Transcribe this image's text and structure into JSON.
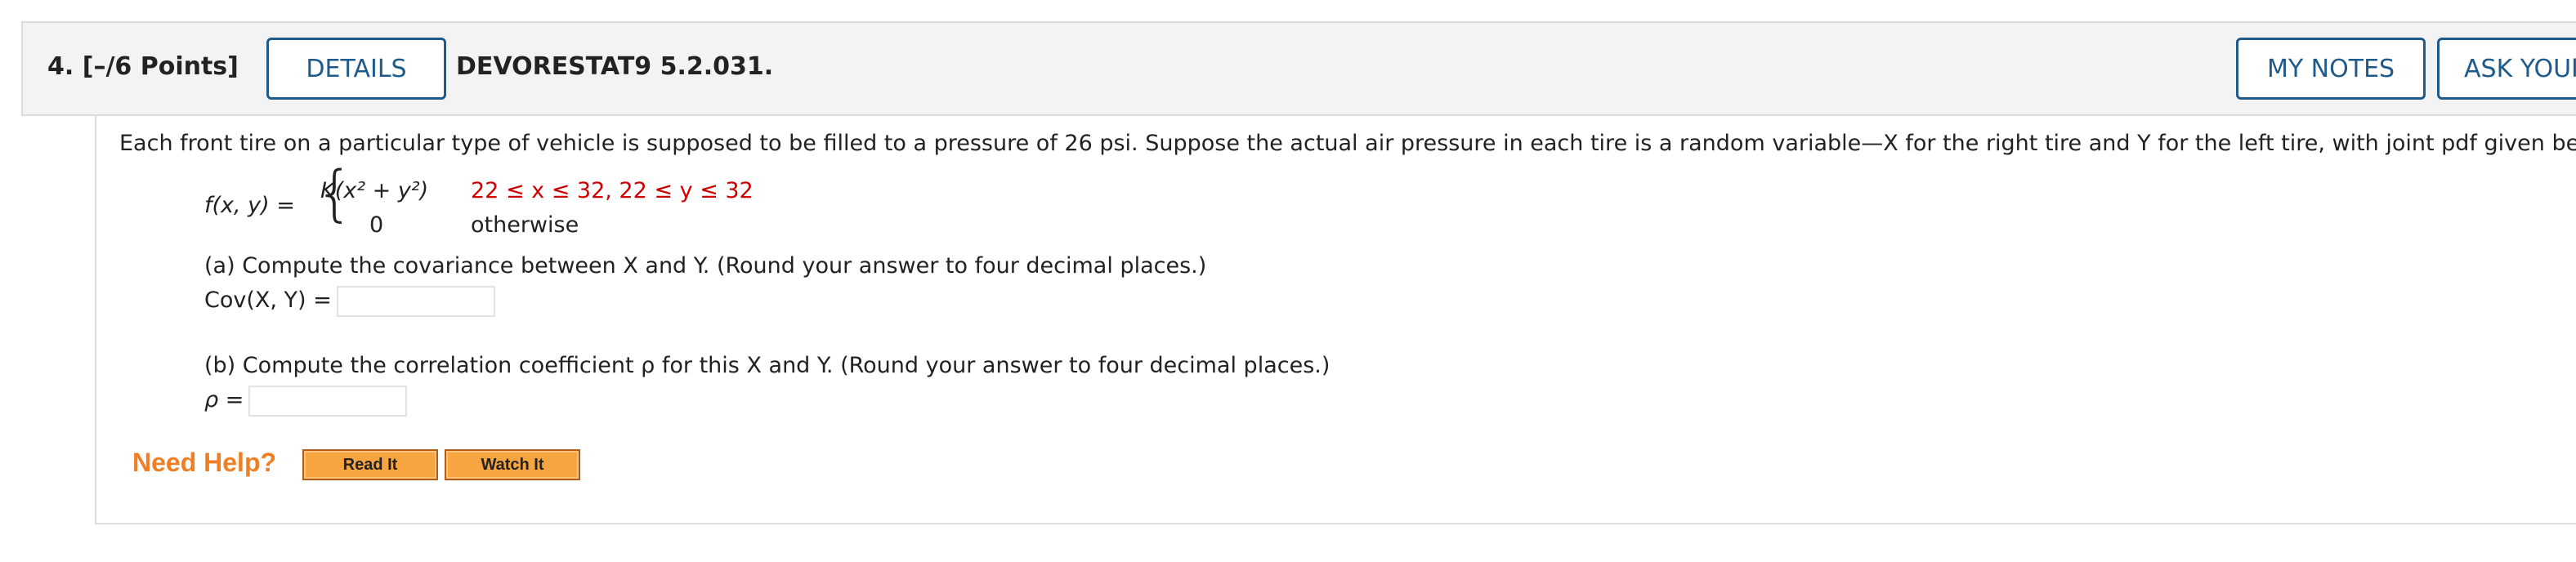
{
  "header": {
    "question_number": "4.",
    "points": "[–/6 Points]",
    "details_label": "DETAILS",
    "assignment_code": "DEVORESTAT9 5.2.031.",
    "my_notes_label": "MY NOTES",
    "ask_your_label": "ASK YOUR TEACHER"
  },
  "problem": {
    "intro": "Each front tire on a particular type of vehicle is supposed to be filled to a pressure of 26 psi. Suppose the actual air pressure in each tire is a random variable—X for the right tire and Y for the left tire, with joint pdf given below.",
    "pdf_lhs": "f(x, y) =",
    "case1_expr": "K(x² + y²)",
    "case1_range": "22 ≤ x ≤ 32, 22 ≤ y ≤ 32",
    "case2_expr": "0",
    "case2_range": "otherwise",
    "part_a": "(a) Compute the covariance between X and Y. (Round your answer to four decimal places.)",
    "part_a_label": "Cov(X, Y) =",
    "part_a_value": "",
    "part_b": "(b) Compute the correlation coefficient ρ for this X and Y. (Round your answer to four decimal places.)",
    "part_b_label": "ρ =",
    "part_b_value": ""
  },
  "help": {
    "need_help": "Need Help?",
    "read_it": "Read It",
    "watch_it": "Watch It"
  },
  "colors": {
    "accent_blue": "#1e5a8a",
    "need_help_orange": "#f07e24",
    "button_orange": "#f6a540",
    "highlight_red": "#cc0000"
  }
}
